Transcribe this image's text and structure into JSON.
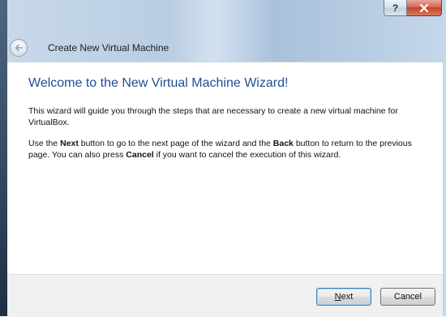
{
  "window": {
    "help_label": "?",
    "close_icon": "close-icon"
  },
  "header": {
    "title": "Create New Virtual Machine",
    "back_icon": "back-arrow-icon"
  },
  "content": {
    "heading": "Welcome to the New Virtual Machine Wizard!",
    "paragraph1": "This wizard will guide you through the steps that are necessary to create a new virtual machine for VirtualBox.",
    "p2_part1": "Use the ",
    "p2_next": "Next",
    "p2_part2": " button to go to the next page of the wizard and the ",
    "p2_back": "Back",
    "p2_part3": " button to return to the previous page. You can also press ",
    "p2_cancel": "Cancel",
    "p2_part4": " if you want to cancel the execution of this wizard."
  },
  "footer": {
    "next_mnemonic": "N",
    "next_rest": "ext",
    "cancel_label": "Cancel"
  }
}
